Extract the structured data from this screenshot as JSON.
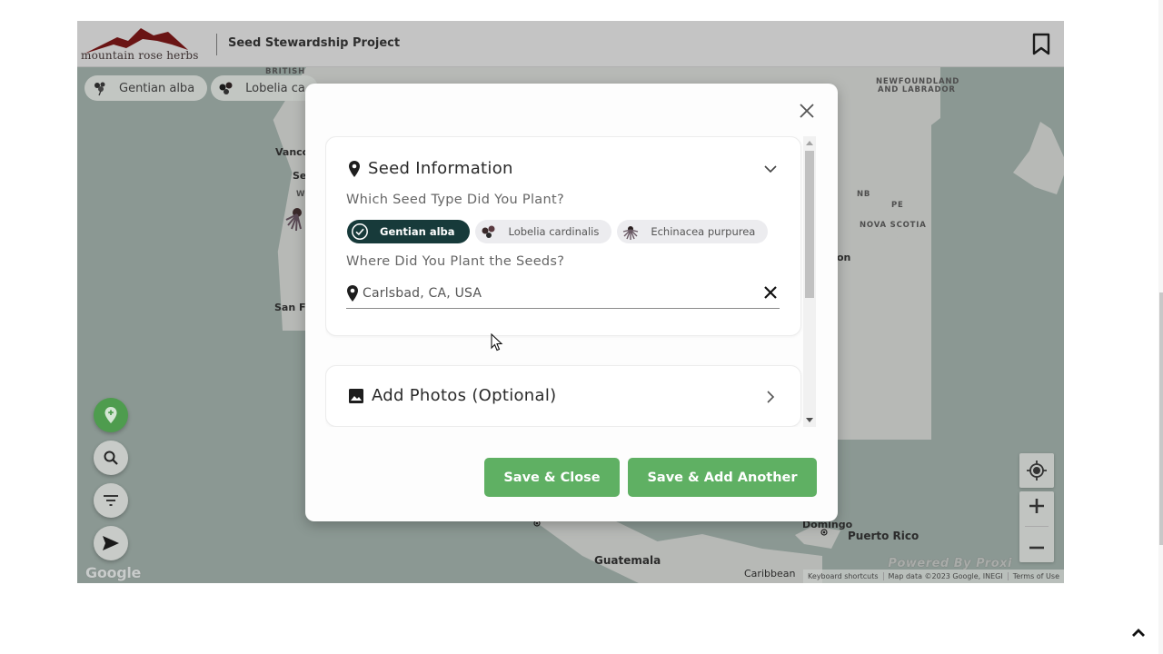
{
  "header": {
    "logo_text": "mountain rose herbs",
    "title": "Seed Stewardship Project",
    "bookmark_icon": "bookmark-icon"
  },
  "map": {
    "chips": [
      {
        "label": "Gentian alba",
        "icon": "gentian-flower-icon"
      },
      {
        "label": "Lobelia ca",
        "icon": "lobelia-flower-icon"
      }
    ],
    "labels": {
      "british": "BRITISH",
      "vancouver": "Vanco",
      "seattle": "Se",
      "wa": "W",
      "san_francisco": "San Fr",
      "newfoundland_1": "NEWFOUNDLAND",
      "newfoundland_2": "AND LABRADOR",
      "nb": "NB",
      "pe": "PE",
      "nova_scotia": "NOVA SCOTIA",
      "boston": "on",
      "domingo": "Domingo",
      "puerto_rico": "Puerto Rico",
      "guatemala": "Guatemala",
      "caribbean": "Caribbean"
    },
    "fabs": [
      {
        "name": "add-location-button",
        "icon": "add-pin-icon"
      },
      {
        "name": "search-button",
        "icon": "search-icon"
      },
      {
        "name": "filter-button",
        "icon": "filter-icon"
      },
      {
        "name": "navigate-button",
        "icon": "send-icon"
      }
    ],
    "google_logo": "Google",
    "powered_by": "Powered By Proxi",
    "attribution": {
      "keyboard": "Keyboard shortcuts",
      "map_data": "Map data ©2023 Google, INEGI",
      "terms": "Terms of Use"
    }
  },
  "modal": {
    "seed_section": {
      "title": "Seed Information",
      "seed_question": "Which Seed Type Did You Plant?",
      "seed_options": [
        {
          "label": "Gentian alba",
          "selected": true
        },
        {
          "label": "Lobelia cardinalis",
          "selected": false
        },
        {
          "label": "Echinacea purpurea",
          "selected": false
        }
      ],
      "location_question": "Where Did You Plant the Seeds?",
      "location_value": "Carlsbad, CA, USA"
    },
    "photo_section": {
      "title": "Add Photos (Optional)"
    },
    "buttons": {
      "save_close": "Save & Close",
      "save_add_another": "Save & Add Another"
    }
  },
  "colors": {
    "primary_green": "#5fb063",
    "selected_chip": "#173a3a",
    "map_water": "#8b9893",
    "map_land": "#b7b9b6"
  }
}
